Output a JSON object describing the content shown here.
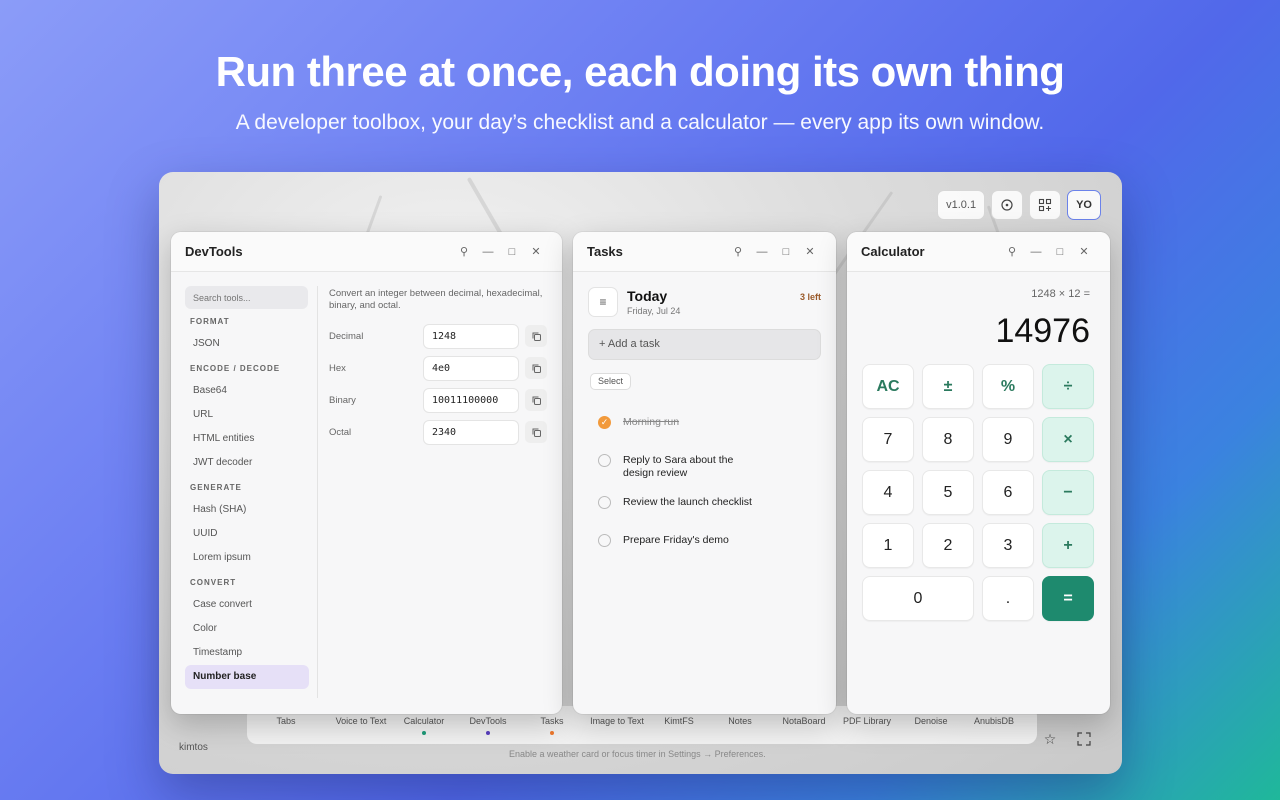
{
  "hero": {
    "title": "Run three at once, each doing its own thing",
    "subtitle": "A developer toolbox, your day’s checklist and a calculator — every app its own window."
  },
  "topbar": {
    "version": "v1.0.1",
    "user_initials": "YO"
  },
  "devtools": {
    "title": "DevTools",
    "search_placeholder": "Search tools...",
    "sections": [
      {
        "label": "FORMAT",
        "items": [
          "JSON"
        ]
      },
      {
        "label": "ENCODE / DECODE",
        "items": [
          "Base64",
          "URL",
          "HTML entities",
          "JWT decoder"
        ]
      },
      {
        "label": "GENERATE",
        "items": [
          "Hash (SHA)",
          "UUID",
          "Lorem ipsum"
        ]
      },
      {
        "label": "CONVERT",
        "items": [
          "Case convert",
          "Color",
          "Timestamp",
          "Number base"
        ]
      }
    ],
    "active_item": "Number base",
    "description": "Convert an integer between decimal, hexadecimal, binary, and octal.",
    "fields": [
      {
        "label": "Decimal",
        "value": "1248"
      },
      {
        "label": "Hex",
        "value": "4e0"
      },
      {
        "label": "Binary",
        "value": "10011100000"
      },
      {
        "label": "Octal",
        "value": "2340"
      }
    ]
  },
  "tasks": {
    "title": "Tasks",
    "heading": "Today",
    "date": "Friday, Jul 24",
    "remaining": "3 left",
    "add_placeholder": "+ Add a task",
    "select_label": "Select",
    "items": [
      {
        "text": "Morning run",
        "done": true
      },
      {
        "text": "Reply to Sara about the design review",
        "done": false
      },
      {
        "text": "Review the launch checklist",
        "done": false
      },
      {
        "text": "Prepare Friday's demo",
        "done": false
      }
    ]
  },
  "calculator": {
    "title": "Calculator",
    "expression": "1248 × 12 =",
    "result": "14976",
    "keys": [
      {
        "label": "AC",
        "kind": "fn"
      },
      {
        "label": "±",
        "kind": "fn"
      },
      {
        "label": "%",
        "kind": "fn"
      },
      {
        "label": "÷",
        "kind": "op"
      },
      {
        "label": "7",
        "kind": "num"
      },
      {
        "label": "8",
        "kind": "num"
      },
      {
        "label": "9",
        "kind": "num"
      },
      {
        "label": "×",
        "kind": "op"
      },
      {
        "label": "4",
        "kind": "num"
      },
      {
        "label": "5",
        "kind": "num"
      },
      {
        "label": "6",
        "kind": "num"
      },
      {
        "label": "−",
        "kind": "op"
      },
      {
        "label": "1",
        "kind": "num"
      },
      {
        "label": "2",
        "kind": "num"
      },
      {
        "label": "3",
        "kind": "num"
      },
      {
        "label": "+",
        "kind": "op"
      },
      {
        "label": "0",
        "kind": "num"
      },
      {
        "label": ".",
        "kind": "num"
      },
      {
        "label": "=",
        "kind": "eq"
      }
    ]
  },
  "dock": {
    "items": [
      {
        "label": "Tabs",
        "dot": ""
      },
      {
        "label": "Voice to Text",
        "dot": ""
      },
      {
        "label": "Calculator",
        "dot": "#1e9c7a"
      },
      {
        "label": "DevTools",
        "dot": "#5a3fc0"
      },
      {
        "label": "Tasks",
        "dot": "#f07a2e"
      },
      {
        "label": "Image to Text",
        "dot": ""
      },
      {
        "label": "KimtFS",
        "dot": ""
      },
      {
        "label": "Notes",
        "dot": ""
      },
      {
        "label": "NotaBoard",
        "dot": ""
      },
      {
        "label": "PDF Library",
        "dot": ""
      },
      {
        "label": "Denoise",
        "dot": ""
      },
      {
        "label": "AnubisDB",
        "dot": ""
      }
    ]
  },
  "footer": {
    "brand": "kimtos",
    "hint": "Enable a weather card or focus timer in Settings → Preferences."
  },
  "colors": {
    "accent": "#1e8a6e",
    "task_check": "#f29a3c",
    "active_nav": "#e6e0f7"
  }
}
